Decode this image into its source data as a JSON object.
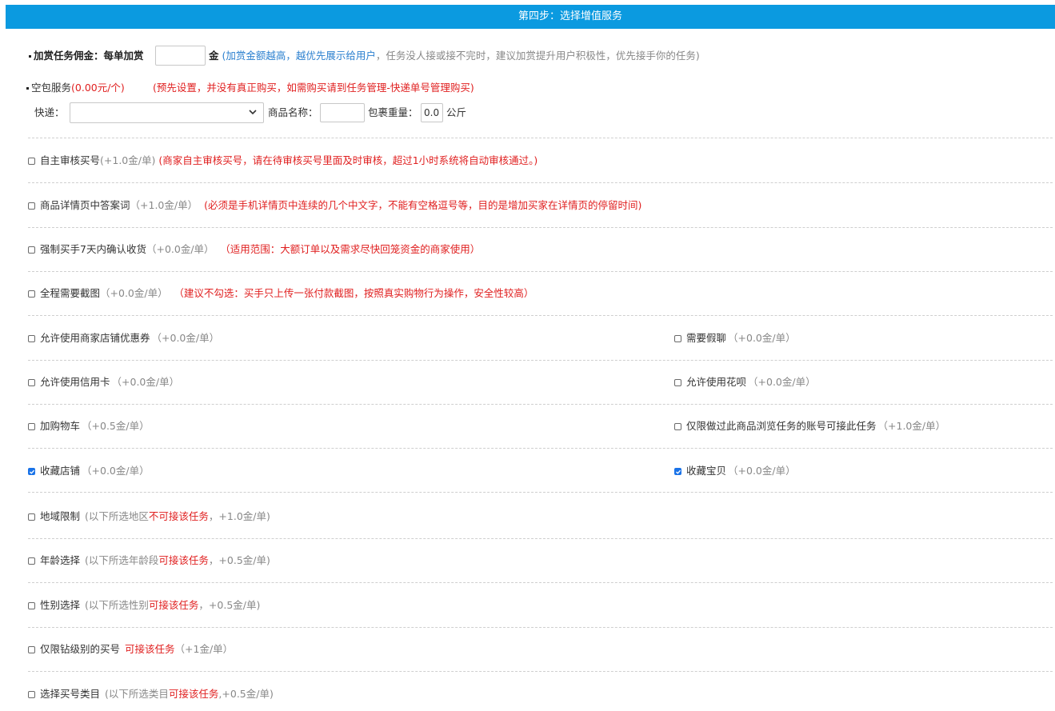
{
  "header": {
    "title": "第四步：选择增值服务"
  },
  "reward": {
    "label": "加赏任务佣金：",
    "per_order": "每单加赏",
    "unit": "金",
    "note_blue": "(加赏金额越高，越优先展示给用户",
    "note_gray": "，任务没人接或接不完时，建议加赏提升用户积极性，优先接手你的任务)"
  },
  "empty_package": {
    "label": "空包服务",
    "price": "(0.00元/个)",
    "note": "(预先设置，并没有真正购买，如需购买请到任务管理-快递单号管理购买)",
    "express_label": "快递：",
    "product_label": "商品名称：",
    "weight_label": "包裹重量：",
    "weight_value": "0.0",
    "weight_unit": "公斤"
  },
  "options": [
    {
      "label": "自主审核买号",
      "price": "(+1.0金/单)",
      "note": "(商家自主审核买号，请在待审核买号里面及时审核，超过1小时系统将自动审核通过。)",
      "checked": false
    },
    {
      "label": "商品详情页中答案词",
      "price": "（+1.0金/单）",
      "note": "(必须是手机详情页中连续的几个中文字，不能有空格逗号等，目的是增加买家在详情页的停留时间)",
      "checked": false
    },
    {
      "label": "强制买手7天内确认收货",
      "price": "（+0.0金/单）",
      "note": "（适用范围：大额订单以及需求尽快回笼资金的商家使用）",
      "checked": false
    },
    {
      "label": "全程需要截图",
      "price": "（+0.0金/单）",
      "note": "（建议不勾选：买手只上传一张付款截图，按照真实购物行为操作，安全性较高）",
      "checked": false
    }
  ],
  "pairs": [
    {
      "left": {
        "label": "允许使用商家店铺优惠券",
        "price": "（+0.0金/单）",
        "checked": false
      },
      "right": {
        "label": "需要假聊",
        "price": "（+0.0金/单）",
        "checked": false
      }
    },
    {
      "left": {
        "label": "允许使用信用卡",
        "price": "（+0.0金/单）",
        "checked": false
      },
      "right": {
        "label": "允许使用花呗",
        "price": "（+0.0金/单）",
        "checked": false
      }
    },
    {
      "left": {
        "label": "加购物车",
        "price": "（+0.5金/单）",
        "checked": false
      },
      "right": {
        "label": "仅限做过此商品浏览任务的账号可接此任务",
        "price": "（+1.0金/单）",
        "checked": false
      }
    },
    {
      "left": {
        "label": "收藏店铺",
        "price": "（+0.0金/单）",
        "checked": true
      },
      "right": {
        "label": "收藏宝贝",
        "price": "（+0.0金/单）",
        "checked": true
      }
    }
  ],
  "restrictions": [
    {
      "label": "地域限制",
      "pre": "(以下所选地区",
      "red": "不可接该任务",
      "post": "，+1.0金/单)",
      "checked": false
    },
    {
      "label": "年龄选择",
      "pre": "(以下所选年龄段",
      "red": "可接该任务",
      "post": "，+0.5金/单)",
      "checked": false
    },
    {
      "label": "性别选择",
      "pre": "(以下所选性别",
      "red": "可接该任务",
      "post": "，+0.5金/单)",
      "checked": false
    },
    {
      "label": "仅限钻级别的买号",
      "pre": "",
      "red": "可接该任务",
      "post": "（+1金/单）",
      "checked": false
    },
    {
      "label": "选择买号类目",
      "pre": "(以下所选类目",
      "red": "可接该任务",
      "post": ",+0.5金/单)",
      "checked": false
    }
  ],
  "colors": {
    "header_bg": "#0b9ae0",
    "note_red": "#e02020",
    "note_blue": "#2a7fcf",
    "checkbox_checked": "#1a73e8"
  }
}
